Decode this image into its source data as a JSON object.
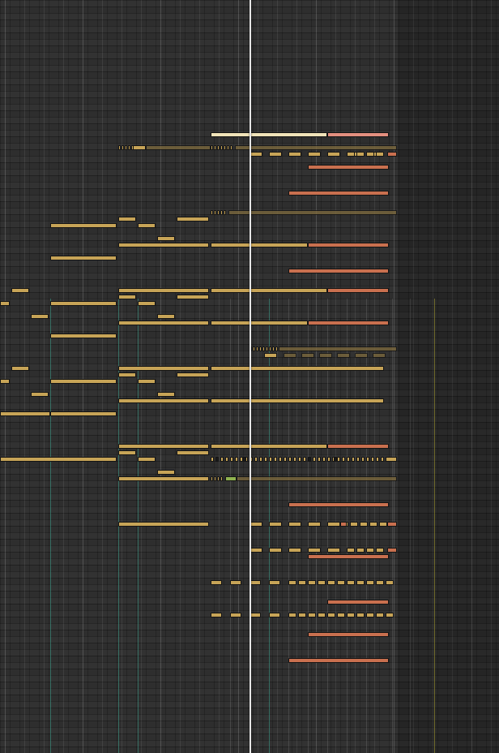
{
  "app": {
    "view": "piano-roll"
  },
  "colors": {
    "background": "#2e2e2e",
    "note": "#c7a457",
    "note_selected": "#c9704f",
    "note_highlight": "#f0e3b8",
    "note_dim": "#7f6a3d",
    "playhead": "#e6e6e6",
    "marker_teal": "#3ca08c",
    "marker_olive": "#aaa032"
  },
  "playhead": {
    "visible": true
  }
}
